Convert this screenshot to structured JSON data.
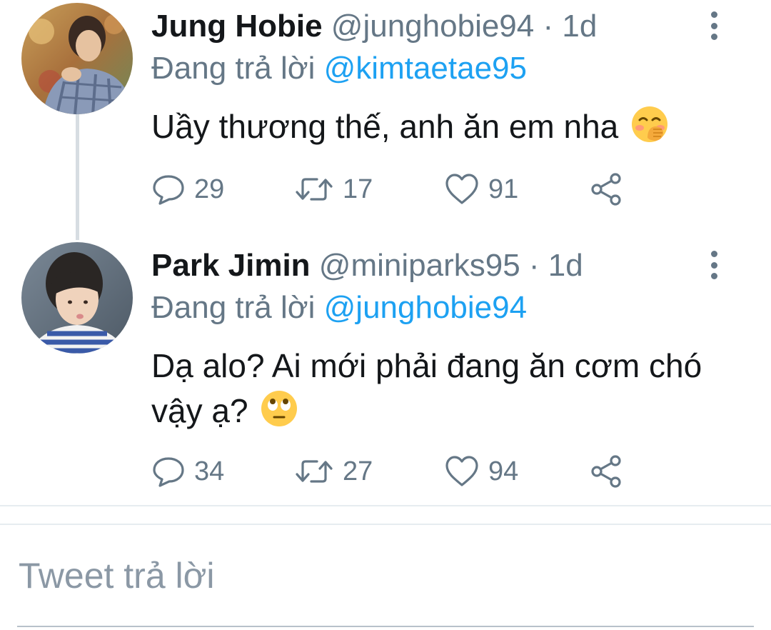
{
  "thread": [
    {
      "name": "Jung Hobie",
      "handle": "@junghobie94",
      "separator": "·",
      "time": "1d",
      "replying_label": "Đang trả lời",
      "replying_to": "@kimtaetae95",
      "text": "Uầy thương thế, anh ăn em nha",
      "emoji": "hand-over-mouth-emoji",
      "stats": {
        "replies": "29",
        "retweets": "17",
        "likes": "91"
      }
    },
    {
      "name": "Park Jimin",
      "handle": "@miniparks95",
      "separator": "·",
      "time": "1d",
      "replying_label": "Đang trả lời",
      "replying_to": "@junghobie94",
      "text": "Dạ alo? Ai mới phải đang ăn cơm chó vậy ạ?",
      "emoji": "rolling-eyes-emoji",
      "stats": {
        "replies": "34",
        "retweets": "27",
        "likes": "94"
      }
    }
  ],
  "reply_box": {
    "placeholder": "Tweet trả lời",
    "value": ""
  },
  "colors": {
    "text": "#14171a",
    "secondary": "#657786",
    "link": "#1da1f2",
    "divider": "#e6ecf0",
    "thread_line": "#d7dde2"
  }
}
